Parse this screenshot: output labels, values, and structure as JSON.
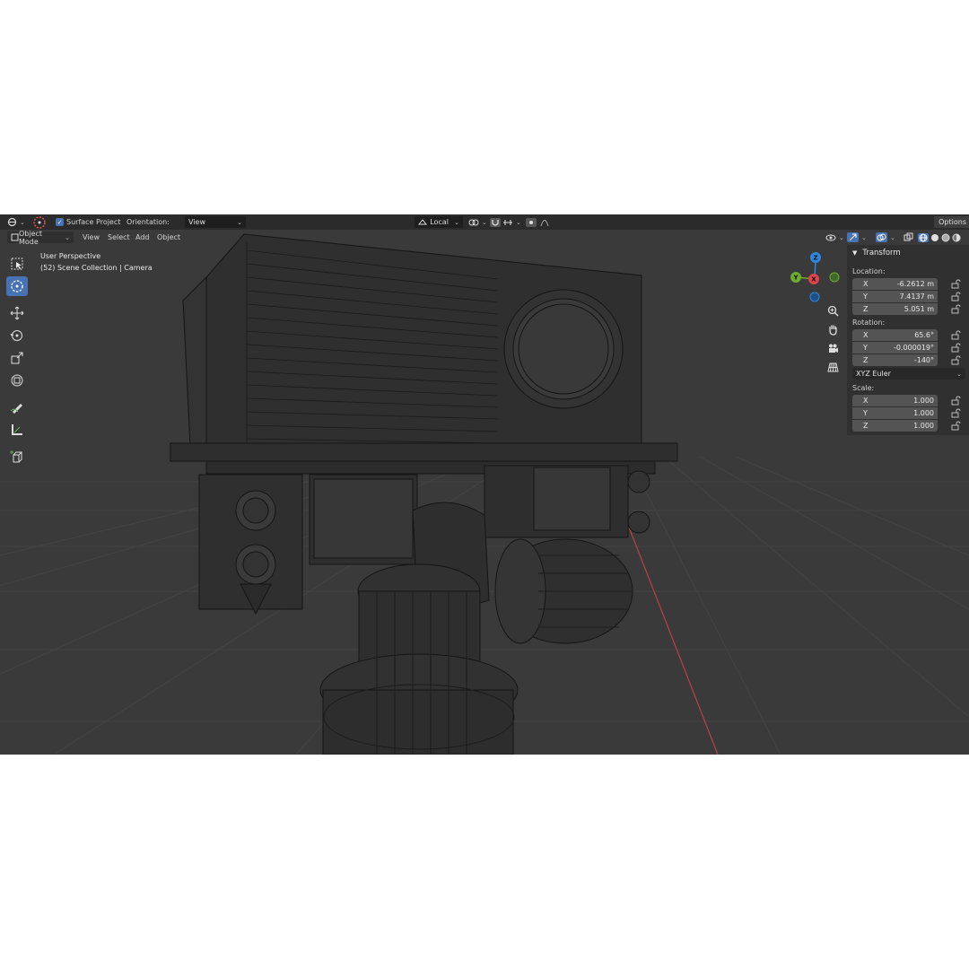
{
  "tool_header": {
    "surface_project_label": "Surface Project",
    "surface_project_checked": true,
    "orientation_label": "Orientation:",
    "orientation_value": "View",
    "pivot_value": "Local",
    "options_label": "Options"
  },
  "menu_header": {
    "mode": "Object Mode",
    "menus": [
      "View",
      "Select",
      "Add",
      "Object"
    ]
  },
  "viewport": {
    "perspective": "User Perspective",
    "collection": "(52) Scene Collection | Camera",
    "gizmo_axes": {
      "x": "X",
      "y": "Y",
      "z": "Z"
    },
    "axis_colors": {
      "x": "#e0434f",
      "y": "#6eab30",
      "z": "#2e86de"
    }
  },
  "toolbar": {
    "tools": [
      "select-box",
      "cursor",
      "move",
      "rotate",
      "scale",
      "transform",
      "annotate",
      "measure",
      "add-cube"
    ],
    "active": "cursor"
  },
  "transform_panel": {
    "title": "Transform",
    "location_label": "Location:",
    "location": [
      {
        "axis": "X",
        "value": "-6.2612 m"
      },
      {
        "axis": "Y",
        "value": "7.4137 m"
      },
      {
        "axis": "Z",
        "value": "5.051 m"
      }
    ],
    "rotation_label": "Rotation:",
    "rotation": [
      {
        "axis": "X",
        "value": "65.6°"
      },
      {
        "axis": "Y",
        "value": "-0.000019°"
      },
      {
        "axis": "Z",
        "value": "-140°"
      }
    ],
    "rotation_mode": "XYZ Euler",
    "scale_label": "Scale:",
    "scale": [
      {
        "axis": "X",
        "value": "1.000"
      },
      {
        "axis": "Y",
        "value": "1.000"
      },
      {
        "axis": "Z",
        "value": "1.000"
      }
    ]
  },
  "colors": {
    "background": "#3a3a3a",
    "header": "#2b2b2b",
    "accent": "#4772b3",
    "panel": "#303030",
    "field": "#545454"
  }
}
